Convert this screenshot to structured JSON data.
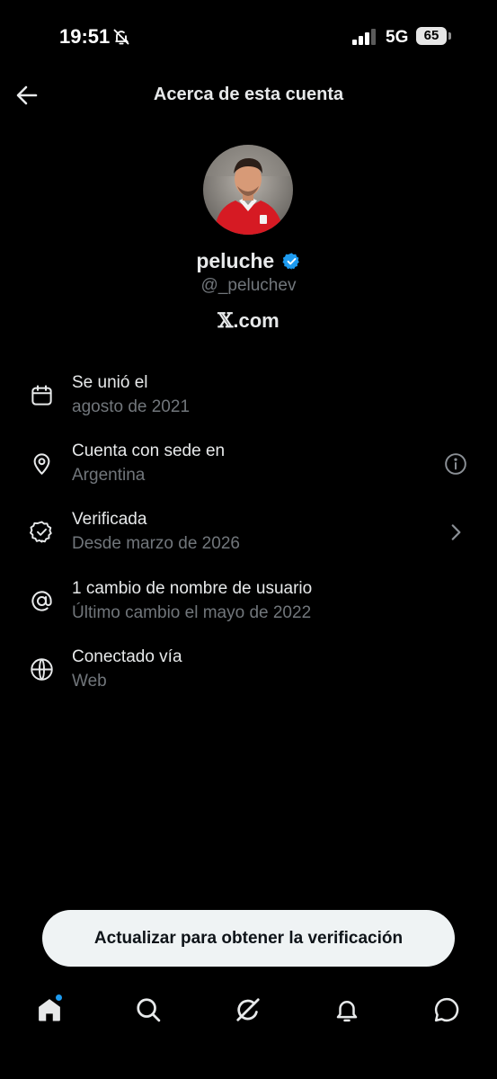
{
  "status_bar": {
    "time": "19:51",
    "network": "5G",
    "battery": "65",
    "icons": [
      "bell-off-icon",
      "signal-icon",
      "battery-icon"
    ]
  },
  "header": {
    "title": "Acerca de esta cuenta",
    "back_icon": "arrow-left-icon"
  },
  "profile": {
    "display_name": "peluche",
    "handle": "@_peluchev",
    "verified": true,
    "verified_color": "#1d9bf0",
    "platform": ".com",
    "platform_glyph": "𝕏"
  },
  "info_rows": [
    {
      "icon": "calendar-icon",
      "title": "Se unió el",
      "subtitle": "agosto de 2021",
      "trailing": null
    },
    {
      "icon": "location-pin-icon",
      "title": "Cuenta con sede en",
      "subtitle": "Argentina",
      "trailing": "info-icon"
    },
    {
      "icon": "verified-badge-icon",
      "title": "Verificada",
      "subtitle": "Desde marzo de 2026",
      "trailing": "chevron-right-icon"
    },
    {
      "icon": "at-sign-icon",
      "title": "1 cambio de nombre de usuario",
      "subtitle": "Último cambio el mayo de 2022",
      "trailing": null
    },
    {
      "icon": "globe-icon",
      "title": "Conectado vía",
      "subtitle": "Web",
      "trailing": null
    }
  ],
  "cta": {
    "label": "Actualizar para obtener la verificación"
  },
  "tab_bar": {
    "tabs": [
      "home-icon",
      "search-icon",
      "grok-icon",
      "bell-icon",
      "chat-icon"
    ],
    "notification_dot_color": "#1d9bf0"
  },
  "colors": {
    "background": "#000000",
    "primary_text": "#e7e9ea",
    "secondary_text": "#71767b",
    "accent": "#1d9bf0"
  }
}
